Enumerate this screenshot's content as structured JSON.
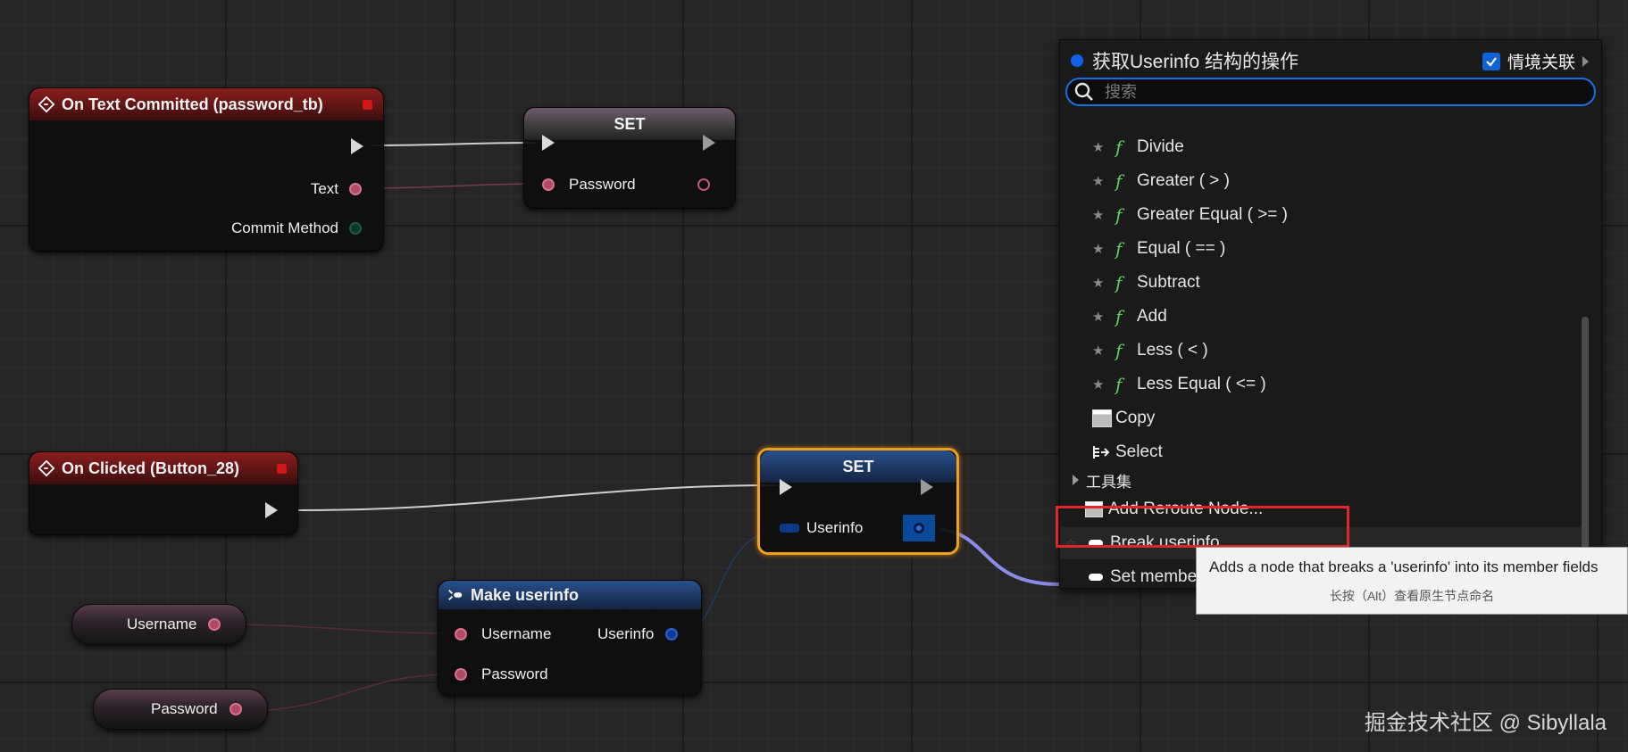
{
  "nodes": {
    "text_committed": {
      "title": "On Text Committed (password_tb)",
      "pins": [
        "Text",
        "Commit Method"
      ]
    },
    "set_password": {
      "title": "SET",
      "pin": "Password"
    },
    "on_clicked": {
      "title": "On Clicked (Button_28)"
    },
    "set_userinfo": {
      "title": "SET",
      "pin": "Userinfo"
    },
    "make_userinfo": {
      "title": "Make userinfo",
      "in_pins": [
        "Username",
        "Password"
      ],
      "out_pin": "Userinfo"
    },
    "var_username": {
      "label": "Username"
    },
    "var_password": {
      "label": "Password"
    }
  },
  "menu": {
    "title": "获取Userinfo 结构的操作",
    "context_label": "情境关联",
    "context_checked": true,
    "search_placeholder": "搜索",
    "functions": [
      "Divide",
      "Greater ( > )",
      "Greater Equal ( >= )",
      "Equal ( == )",
      "Subtract",
      "Add",
      "Less ( < )",
      "Less Equal ( <= )"
    ],
    "copy": "Copy",
    "select": "Select",
    "category": "工具集",
    "reroute": "Add Reroute Node...",
    "break": "Break userinfo",
    "set_members": "Set members in userinfo",
    "set_members_visible": "Set membe"
  },
  "tooltip": {
    "text": "Adds a node that breaks a 'userinfo' into its member fields",
    "hint": "长按（Alt）查看原生节点命名"
  },
  "watermark": "掘金技术社区 @ Sibyllala",
  "colors": {
    "exec": "#d8d8d8",
    "string_pin": "#b04a66",
    "struct_pin": "#2a62d0",
    "highlight": "#e0262c",
    "selection": "#f0a020"
  }
}
